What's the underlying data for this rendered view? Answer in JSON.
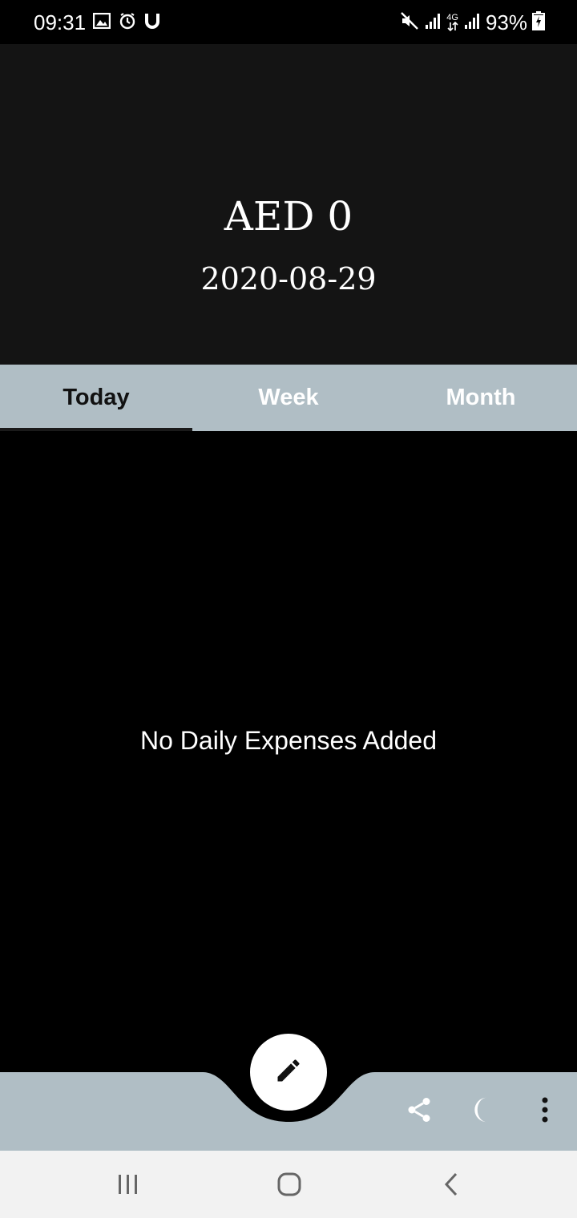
{
  "status_bar": {
    "time": "09:31",
    "battery": "93%",
    "network": "4G",
    "left_icons": [
      "gallery-icon",
      "timer-icon",
      "u-icon"
    ],
    "right_icons": [
      "mute-icon",
      "signal-icon",
      "network-4g-icon",
      "signal-icon",
      "battery-charging-icon"
    ]
  },
  "header": {
    "amount": "AED 0",
    "date": "2020-08-29",
    "background": "#141414"
  },
  "tabs": [
    {
      "label": "Today",
      "active": true
    },
    {
      "label": "Week",
      "active": false
    },
    {
      "label": "Month",
      "active": false
    }
  ],
  "content": {
    "empty_message": "No Daily Expenses Added"
  },
  "bottom_bar": {
    "fab_icon": "pencil-icon",
    "actions": [
      "share-icon",
      "moon-icon",
      "more-vert-icon"
    ],
    "color": "#b0bec5"
  },
  "nav_bar": {
    "buttons": [
      "recents-icon",
      "home-icon",
      "back-icon"
    ]
  }
}
